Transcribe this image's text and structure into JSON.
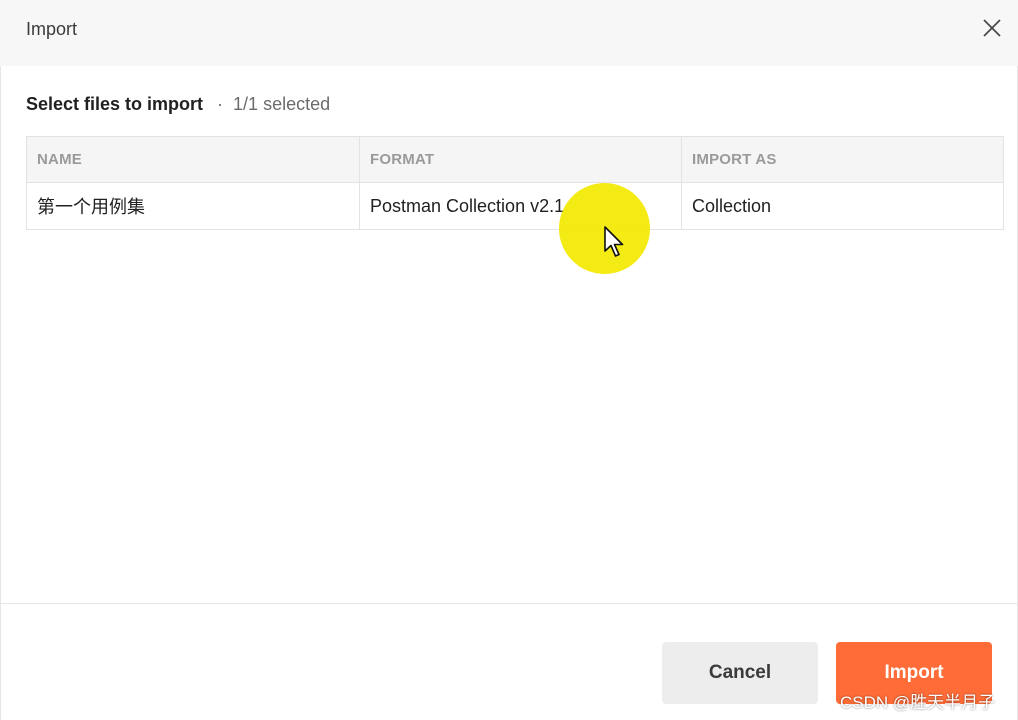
{
  "dialog": {
    "title": "Import",
    "close_icon": "close-icon"
  },
  "selection": {
    "label": "Select files to import",
    "separator": "·",
    "count": "1/1 selected"
  },
  "table": {
    "headers": [
      "NAME",
      "FORMAT",
      "IMPORT AS"
    ],
    "rows": [
      {
        "name": "第一个用例集",
        "format": "Postman Collection v2.1",
        "import_as": "Collection"
      }
    ]
  },
  "footer": {
    "cancel_label": "Cancel",
    "import_label": "Import"
  },
  "watermark": "CSDN @胜天半月子",
  "colors": {
    "accent": "#ff6c37",
    "cursor_highlight": "#f3e800",
    "header_background": "#f7f7f7"
  }
}
